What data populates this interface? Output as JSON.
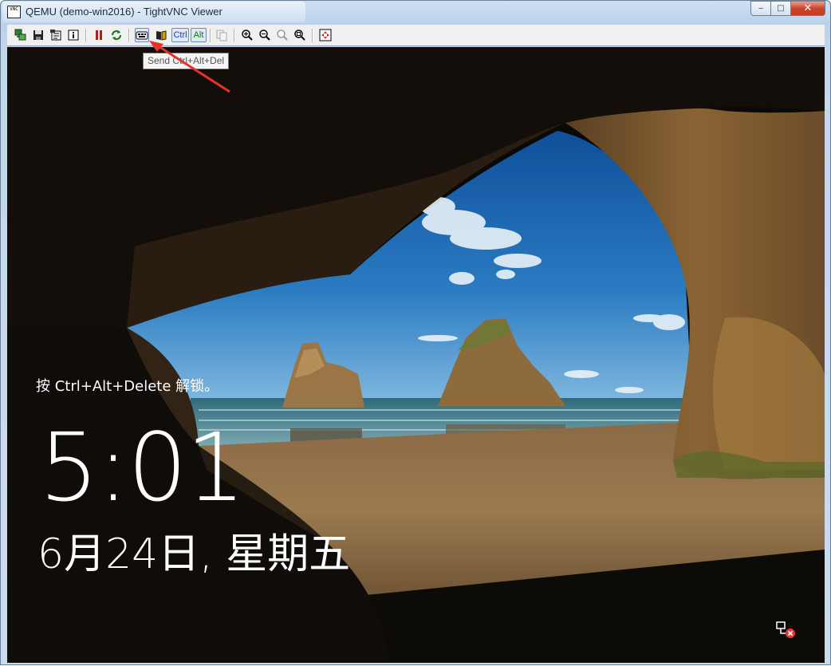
{
  "window": {
    "title": "QEMU (demo-win2016) - TightVNC Viewer",
    "app_icon_text": "VNC",
    "minimize_glyph": "‒",
    "maximize_glyph": "□",
    "close_glyph": "✕"
  },
  "toolbar": {
    "buttons": [
      {
        "name": "new-connection-icon"
      },
      {
        "name": "save-icon"
      },
      {
        "name": "options-icon"
      },
      {
        "name": "connection-info-icon"
      },
      {
        "name": "pause-icon"
      },
      {
        "name": "refresh-icon"
      },
      {
        "name": "send-ctrl-alt-del-icon"
      },
      {
        "name": "send-ctrl-esc-icon"
      },
      {
        "name": "ctrl-toggle",
        "label": "Ctrl"
      },
      {
        "name": "alt-toggle",
        "label": "Alt"
      },
      {
        "name": "transfer-files-icon"
      },
      {
        "name": "zoom-in-icon"
      },
      {
        "name": "zoom-out-icon"
      },
      {
        "name": "zoom-100-icon"
      },
      {
        "name": "zoom-fit-icon"
      },
      {
        "name": "fullscreen-icon"
      }
    ],
    "tooltip": "Send Ctrl+Alt+Del"
  },
  "remote_screen": {
    "lock_hint": "按 Ctrl+Alt+Delete 解锁。",
    "time": "5:01",
    "date": "6月24日, 星期五",
    "network_status_icon": "network-disconnected-icon"
  },
  "colors": {
    "annotation_arrow": "#e8312b",
    "titlebar": "#b9d1ea",
    "close_button": "#c7391f"
  }
}
